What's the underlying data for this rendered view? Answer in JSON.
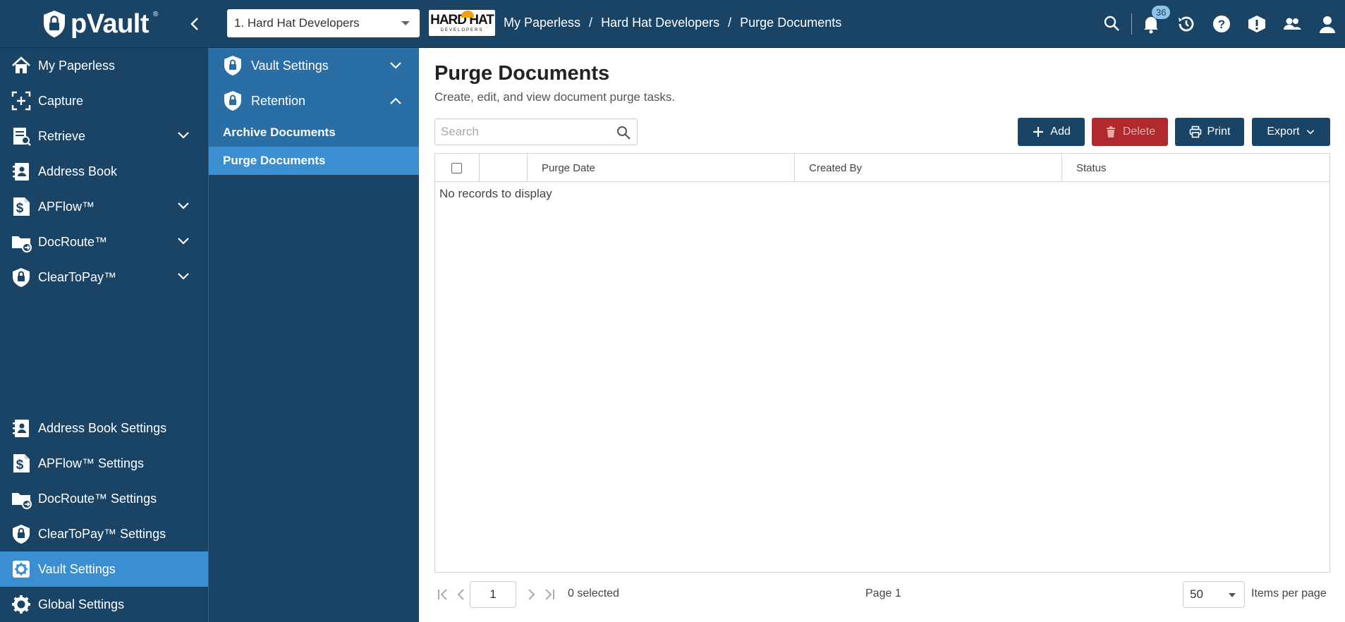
{
  "app": {
    "brand": "pVault",
    "brand_mark": "®"
  },
  "header": {
    "org_select_value": "1. Hard Hat Developers",
    "company_logo_text": "HARD HAT",
    "company_logo_subtext": "DEVELOPERS",
    "breadcrumb": [
      "My Paperless",
      "Hard Hat Developers",
      "Purge Documents"
    ],
    "notification_count": "36",
    "icons": [
      "search-icon",
      "bell-icon",
      "history-icon",
      "help-icon",
      "alert-icon",
      "users-icon",
      "user-icon"
    ]
  },
  "sidebar": {
    "items": [
      {
        "label": "My Paperless",
        "icon": "home-icon"
      },
      {
        "label": "Capture",
        "icon": "capture-icon"
      },
      {
        "label": "Retrieve",
        "icon": "retrieve-icon"
      },
      {
        "label": "Address Book",
        "icon": "address-book-icon"
      },
      {
        "label": "APFlow™",
        "icon": "dollar-doc-icon"
      },
      {
        "label": "DocRoute™",
        "icon": "folder-route-icon"
      },
      {
        "label": "ClearToPay™",
        "icon": "shield-lock-icon"
      }
    ],
    "settings": [
      {
        "label": "Address Book Settings",
        "icon": "address-book-icon"
      },
      {
        "label": "APFlow™ Settings",
        "icon": "dollar-doc-icon"
      },
      {
        "label": "DocRoute™ Settings",
        "icon": "folder-route-icon"
      },
      {
        "label": "ClearToPay™ Settings",
        "icon": "shield-lock-icon"
      },
      {
        "label": "Vault Settings",
        "icon": "gear-icon"
      },
      {
        "label": "Global Settings",
        "icon": "gear-icon"
      }
    ]
  },
  "subnav": {
    "vault_settings": "Vault Settings",
    "retention": "Retention",
    "archive_documents": "Archive Documents",
    "purge_documents": "Purge Documents"
  },
  "main": {
    "title": "Purge Documents",
    "subtitle": "Create, edit, and view document purge tasks.",
    "search_placeholder": "Search",
    "buttons": {
      "add": "Add",
      "delete": "Delete",
      "print": "Print",
      "export": "Export"
    },
    "columns": [
      "Purge Date",
      "Created By",
      "Status"
    ],
    "empty_text": "No records to display",
    "pager": {
      "page_input": "1",
      "selected": "0 selected",
      "page_label": "Page 1",
      "page_size": "50",
      "items_per_page": "Items per page"
    }
  },
  "colors": {
    "nav_bg": "#1a4466",
    "subnav_bg": "#2a6ea6",
    "active_bg": "#3a8fd0",
    "delete_bg": "#b0292c"
  }
}
